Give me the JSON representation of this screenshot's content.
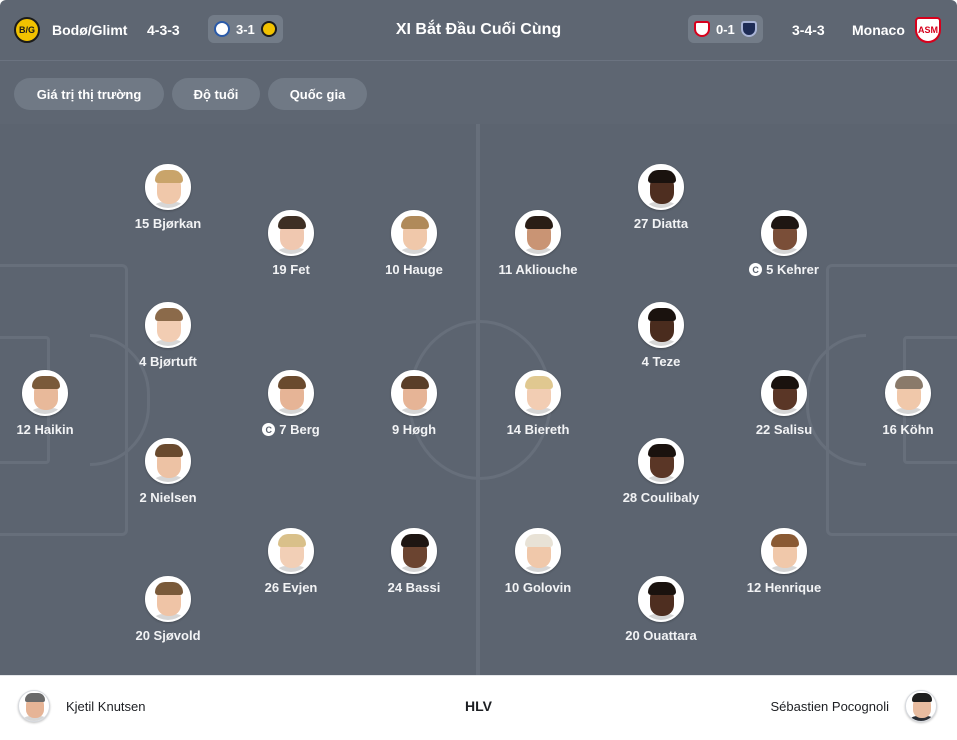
{
  "header": {
    "home_team": "Bodø/Glimt",
    "home_formation": "4-3-3",
    "home_last_score": "3-1",
    "title": "XI Bắt Đầu Cuối Cùng",
    "away_last_score": "0-1",
    "away_formation": "3-4-3",
    "away_team": "Monaco"
  },
  "filters": [
    "Giá trị thị trường",
    "Độ tuổi",
    "Quốc gia"
  ],
  "home_players": [
    {
      "label": "12 Haikin",
      "skin": "#e8b99a",
      "hair": "#7a5a3a"
    },
    {
      "label": "15 Bjørkan",
      "skin": "#f0c8aa",
      "hair": "#c9a46a"
    },
    {
      "label": "4 Bjørtuft",
      "skin": "#f2cdb3",
      "hair": "#8b6a4a"
    },
    {
      "label": "2 Nielsen",
      "skin": "#edc2a4",
      "hair": "#6a4a2e"
    },
    {
      "label": "20 Sjøvold",
      "skin": "#efc4a6",
      "hair": "#7a5a3a"
    },
    {
      "label": "19 Fet",
      "skin": "#f0c8b0",
      "hair": "#3e2f24"
    },
    {
      "label": "7 Berg",
      "skin": "#e6b496",
      "hair": "#6a4a2e",
      "captain": true
    },
    {
      "label": "26 Evjen",
      "skin": "#f2cfb6",
      "hair": "#d9c08a"
    },
    {
      "label": "10 Hauge",
      "skin": "#f0c8aa",
      "hair": "#b08a5a"
    },
    {
      "label": "9 Høgh",
      "skin": "#e6b496",
      "hair": "#5a3e28"
    },
    {
      "label": "24 Bassi",
      "skin": "#6b4430",
      "hair": "#1e1612"
    }
  ],
  "away_players": [
    {
      "label": "16 Köhn",
      "skin": "#f0c8aa",
      "hair": "#8a7a6a"
    },
    {
      "label": "5 Kehrer",
      "skin": "#7a4e38",
      "hair": "#1e1612",
      "captain": true
    },
    {
      "label": "22 Salisu",
      "skin": "#5a3626",
      "hair": "#1a120e"
    },
    {
      "label": "12 Henrique",
      "skin": "#f0c8aa",
      "hair": "#8a5a34"
    },
    {
      "label": "27 Diatta",
      "skin": "#4e2e20",
      "hair": "#1a120e"
    },
    {
      "label": "4 Teze",
      "skin": "#4a2c1e",
      "hair": "#1a120e"
    },
    {
      "label": "28 Coulibaly",
      "skin": "#5a3626",
      "hair": "#1a120e"
    },
    {
      "label": "20 Ouattara",
      "skin": "#4e2e20",
      "hair": "#1a120e"
    },
    {
      "label": "11 Akliouche",
      "skin": "#c99474",
      "hair": "#2a1e16"
    },
    {
      "label": "14 Biereth",
      "skin": "#f2cdb3",
      "hair": "#e0c890"
    },
    {
      "label": "10 Golovin",
      "skin": "#f0c8aa",
      "hair": "#e8e2d6"
    }
  ],
  "captain_badge": "C",
  "coaches": {
    "home": "Kjetil Knutsen",
    "label": "HLV",
    "away": "Sébastien Pocognoli"
  },
  "colors": {
    "pitch": "#5c6470",
    "header": "#5e6672",
    "home_crest": "#f2c200",
    "away_crest": "#d6001c"
  }
}
